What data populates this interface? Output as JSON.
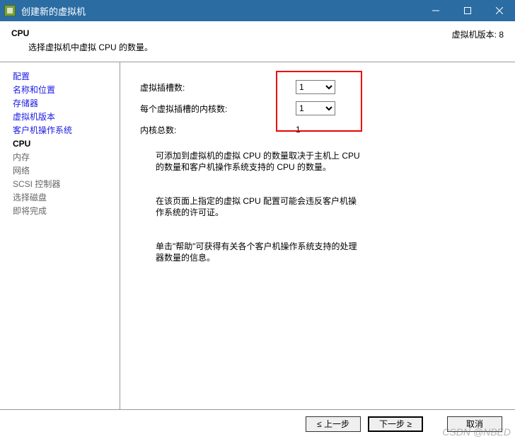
{
  "window": {
    "title": "创建新的虚拟机"
  },
  "header": {
    "title": "CPU",
    "subtitle": "选择虚拟机中虚拟 CPU 的数量。",
    "version_label": "虚拟机版本: 8"
  },
  "sidebar": {
    "items": [
      {
        "label": "配置",
        "state": "link"
      },
      {
        "label": "名称和位置",
        "state": "link"
      },
      {
        "label": "存储器",
        "state": "link"
      },
      {
        "label": "虚拟机版本",
        "state": "link"
      },
      {
        "label": "客户机操作系统",
        "state": "link"
      },
      {
        "label": "CPU",
        "state": "current"
      },
      {
        "label": "内存",
        "state": "future"
      },
      {
        "label": "网络",
        "state": "future"
      },
      {
        "label": "SCSI 控制器",
        "state": "future"
      },
      {
        "label": "选择磁盘",
        "state": "future"
      },
      {
        "label": "即将完成",
        "state": "future"
      }
    ]
  },
  "main": {
    "sockets_label": "虚拟插槽数:",
    "sockets_value": "1",
    "cores_label": "每个虚拟插槽的内核数:",
    "cores_value": "1",
    "total_label": "内核总数:",
    "total_value": "1",
    "info1": "可添加到虚拟机的虚拟 CPU 的数量取决于主机上 CPU 的数量和客户机操作系统支持的 CPU 的数量。",
    "info2": "在该页面上指定的虚拟 CPU 配置可能会违反客户机操作系统的许可证。",
    "info3": "单击\"帮助\"可获得有关各个客户机操作系统支持的处理器数量的信息。"
  },
  "footer": {
    "back": "≤ 上一步",
    "next": "下一步 ≥",
    "cancel": "取消"
  },
  "watermark": "CSDN @NBED"
}
